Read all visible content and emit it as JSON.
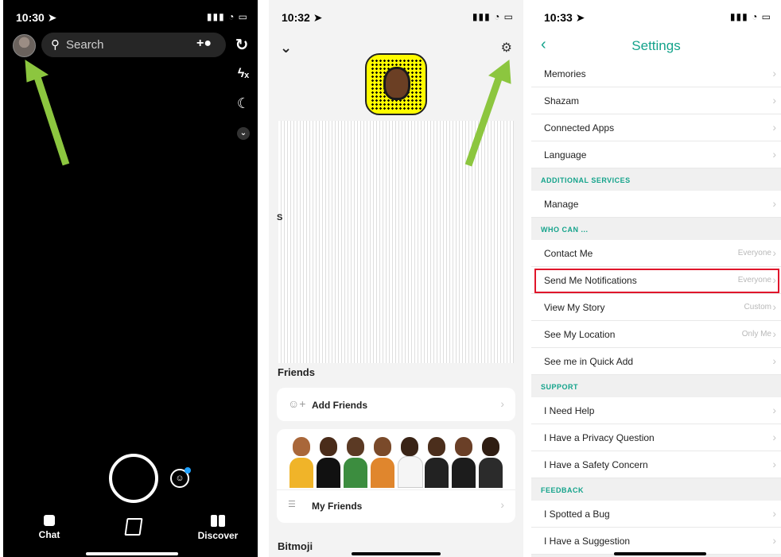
{
  "colors": {
    "accent": "#14a38b",
    "highlight": "#e0162b",
    "pointer_arrow": "#8cc63f",
    "snapcode": "#fffc00"
  },
  "camera": {
    "status_time": "10:30 ➤",
    "status_icons": "▮▮▮ ◔ ▭",
    "search": {
      "icon": "search-icon",
      "placeholder": "Search",
      "add_friend": "+❀"
    },
    "tools": {
      "flip": "↻",
      "flash": "ϟₓ",
      "night": "☾",
      "more": "⌄"
    },
    "nav": {
      "chat": "Chat",
      "discover": "Discover"
    }
  },
  "profile": {
    "status_time": "10:32 ➤",
    "status_icons": "▮▮▮ ◔ ▭",
    "letter": "S",
    "friends_title": "Friends",
    "add_friends": "Add Friends",
    "my_friends": "My Friends",
    "bitmoji_title": "Bitmoji"
  },
  "settings": {
    "status_time": "10:33 ➤",
    "status_icons": "▮▮▮ ◔ ▭",
    "title": "Settings",
    "back": "‹",
    "rows_a": [
      "Memories",
      "Shazam",
      "Connected Apps",
      "Language"
    ],
    "section_additional": "ADDITIONAL SERVICES",
    "manage": "Manage",
    "section_who": "WHO CAN ...",
    "who": [
      {
        "label": "Contact Me",
        "value": "Everyone"
      },
      {
        "label": "Send Me Notifications",
        "value": "Everyone"
      },
      {
        "label": "View My Story",
        "value": "Custom"
      },
      {
        "label": "See My Location",
        "value": "Only Me"
      },
      {
        "label": "See me in Quick Add",
        "value": ""
      }
    ],
    "section_support": "SUPPORT",
    "support": [
      "I Need Help",
      "I Have a Privacy Question",
      "I Have a Safety Concern"
    ],
    "section_feedback": "FEEDBACK",
    "feedback": [
      "I Spotted a Bug",
      "I Have a Suggestion"
    ]
  }
}
